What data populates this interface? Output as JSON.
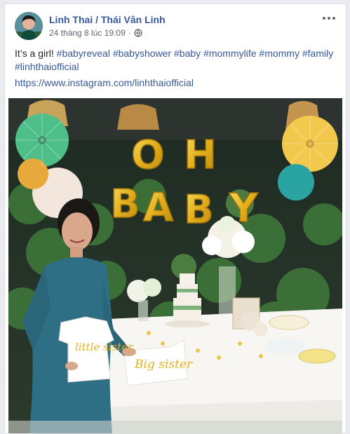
{
  "post": {
    "author": "Linh Thai / Thái Vân Linh",
    "timestamp": "24 tháng 8 lúc 19:09",
    "privacy_icon": "globe-icon",
    "text_intro": "It’s a girl!",
    "hashtags": [
      "#babyreveal",
      "#babyshower",
      "#baby",
      "#mommylife",
      "#mommy",
      "#family",
      "#linhthaiofficial"
    ],
    "link": "https://www.instagram.com/linhthaiofficial"
  },
  "photo": {
    "balloon_letters": [
      "O",
      "H",
      "B",
      "A",
      "B",
      "Y"
    ],
    "onesie_left_text": "little sister",
    "onesie_right_text": "Big sister"
  },
  "colors": {
    "link": "#365899",
    "text": "#1d2129",
    "meta": "#616770",
    "balloon_gold": "#e8b51f",
    "fan_green": "#4fbf8a",
    "fan_teal": "#2aa3a3",
    "fan_yellow": "#f2c94c",
    "dress_teal": "#2e6f86"
  }
}
